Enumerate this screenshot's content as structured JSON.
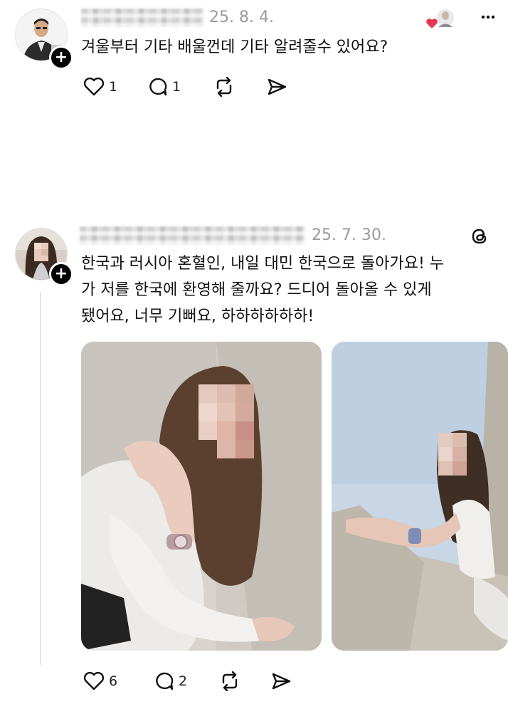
{
  "posts": [
    {
      "date": "25. 8. 4.",
      "text": "겨울부터 기타 배울껀데 기타 알려줄수 있어요?",
      "likes": "1",
      "replies": "1",
      "avatar_icon": "person-avatar-icon",
      "badge": "+"
    },
    {
      "date": "25. 7. 30.",
      "text": "한국과 러시아 혼혈인, 내일 대민 한국으로 돌아가요! 누\n가 저를 한국에 환영해 줄까요? 드디어 돌아올 수 있게\n됐어요, 너무 기뻐요, 하하하하하하!",
      "likes": "6",
      "replies": "2",
      "avatar_icon": "person-avatar-icon",
      "badge": "+"
    }
  ],
  "colors": {
    "heart_red": "#e53950",
    "date_gray": "#9a9a9a",
    "divider": "#e3e3e3"
  }
}
